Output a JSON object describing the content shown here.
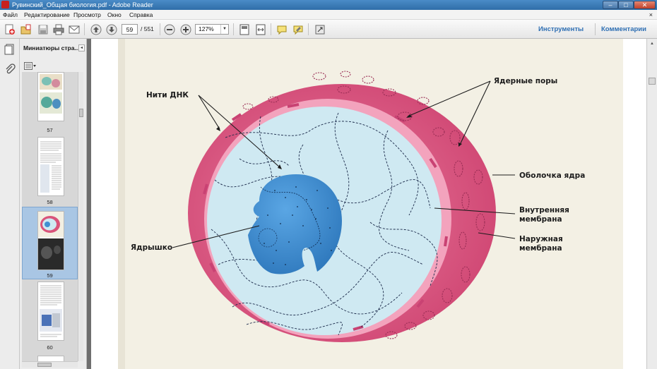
{
  "window": {
    "title": "Рувинский_Общая биология.pdf - Adobe Reader",
    "buttons": [
      "–",
      "□",
      "✕"
    ]
  },
  "menu": {
    "items": [
      "Файл",
      "Редактирование",
      "Просмотр",
      "Окно",
      "Справка"
    ],
    "close": "×"
  },
  "toolbar": {
    "current_page": "59",
    "total_pages": "/  551",
    "zoom": "127%",
    "tools_label": "Инструменты",
    "comments_label": "Комментарии",
    "icons": [
      "create-pdf-icon",
      "open-icon",
      "save-icon",
      "print-icon",
      "email-icon",
      "prev-page-icon",
      "next-page-icon",
      "zoom-out-icon",
      "zoom-in-icon",
      "fit-page-icon",
      "fit-width-icon",
      "comment-icon",
      "highlight-icon",
      "expand-icon"
    ]
  },
  "thumbnails": {
    "title": "Миниатюры стра...",
    "pages": [
      "57",
      "58",
      "59",
      "60"
    ],
    "selected_page": "59"
  },
  "diagram": {
    "labels": {
      "dna": "Нити ДНК",
      "pores": "Ядерные поры",
      "envelope": "Оболочка ядра",
      "inner_1": "Внутренняя",
      "inner_2": "мембрана",
      "nucleolus": "Ядрышко",
      "outer_1": "Наружная",
      "outer_2": "мембрана"
    },
    "colors": {
      "envelope": "#d9537a",
      "inner_membrane": "#f3a3bd",
      "nucleoplasm": "#cfe9f2",
      "nucleolus": "#3f8fd2",
      "page_background": "#f3f0e4"
    }
  }
}
